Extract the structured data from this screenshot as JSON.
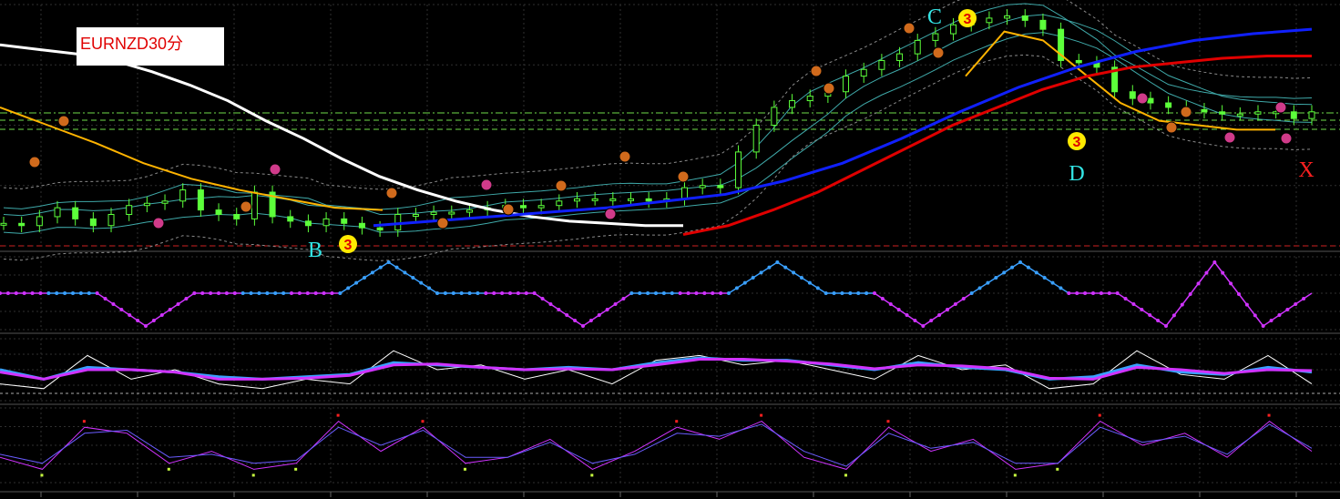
{
  "title": "EURNZD30分",
  "colors": {
    "background": "#000000",
    "grid": "#2f2f2f",
    "candle": "#5cff3a",
    "band": "#3fa9a9",
    "envelope": "#8a8a8a",
    "ma_white": "#ffffff",
    "ma_yellow": "#ffb300",
    "ma_blue": "#1020ff",
    "ma_red": "#e00000",
    "hline_green": "#6fdc4a",
    "hline_red": "#d02020",
    "marker_orange": "#d06a1c",
    "marker_pink": "#d03b8a",
    "marker_yellow": "#ffea00",
    "label_cyan": "#33e6e6",
    "label_red": "#ff2020",
    "osc_magenta": "#d033ff",
    "osc_blue": "#3aa0ff",
    "osc_white": "#ffffff"
  },
  "pattern_labels": [
    {
      "id": "B",
      "text": "B",
      "marker": "3"
    },
    {
      "id": "C",
      "text": "C",
      "marker": "3"
    },
    {
      "id": "D",
      "text": "D",
      "marker": "3"
    },
    {
      "id": "X",
      "text": "X",
      "marker": ""
    }
  ],
  "chart_data": {
    "type": "line",
    "symbol": "EURNZD",
    "timeframe": "30分",
    "panels": [
      {
        "name": "main",
        "series": [
          {
            "kind": "candles",
            "close": [
              6,
              5,
              9,
              13,
              8,
              5,
              10,
              14,
              15,
              16,
              21,
              12,
              10,
              8,
              20,
              9,
              7,
              5,
              8,
              6,
              4,
              3,
              10,
              10,
              11,
              11,
              12,
              13,
              14,
              13,
              14,
              16,
              17,
              17,
              17,
              17,
              16,
              17,
              22,
              23,
              22,
              38,
              50,
              58,
              61,
              63,
              65,
              72,
              75,
              79,
              82,
              88,
              91,
              95,
              96,
              98,
              99,
              97,
              93,
              79,
              78,
              76,
              65,
              62,
              60,
              58,
              57,
              56,
              55,
              55,
              56,
              56,
              53,
              56
            ]
          },
          {
            "kind": "ma",
            "color": "white",
            "values": [
              86,
              84,
              82,
              79,
              74,
              68,
              61,
              52,
              44,
              35,
              27,
              21,
              16,
              12,
              9,
              7,
              6,
              5,
              5
            ]
          },
          {
            "kind": "ma",
            "color": "yellow",
            "values": [
              58,
              50,
              42,
              33,
              26,
              21,
              17,
              13,
              12,
              72,
              92,
              88,
              74,
              60,
              52,
              50,
              48,
              48
            ]
          },
          {
            "kind": "ma",
            "color": "blue",
            "values": [
              5,
              7,
              9,
              11,
              13,
              16,
              19,
              25,
              33,
              44,
              56,
              67,
              76,
              83,
              88,
              91,
              93
            ]
          },
          {
            "kind": "ma",
            "color": "red",
            "values": [
              1,
              5,
              12,
              20,
              30,
              40,
              50,
              58,
              66,
              72,
              76,
              78,
              80,
              81,
              81
            ]
          }
        ]
      },
      {
        "name": "oscillator_1",
        "series": [
          {
            "kind": "step",
            "values": [
              0.5,
              0.5,
              0.5,
              -1,
              0.5,
              0.5,
              0.5,
              0.5,
              1,
              0.5,
              0.5,
              0.5,
              -1,
              0.5,
              0.5,
              0.5,
              1,
              0.5,
              0.5,
              -1,
              0.5,
              1,
              0.5,
              0.5,
              -1,
              1,
              -1,
              0.5
            ]
          }
        ]
      },
      {
        "name": "oscillator_2",
        "series": [
          {
            "name": "",
            "color": "white",
            "values": [
              0.2,
              0.1,
              0.8,
              0.3,
              0.5,
              0.2,
              0.1,
              0.3,
              0.2,
              0.9,
              0.5,
              0.6,
              0.3,
              0.5,
              0.2,
              0.7,
              0.8,
              0.6,
              0.7,
              0.5,
              0.3,
              0.8,
              0.5,
              0.6,
              0.1,
              0.2,
              0.9,
              0.4,
              0.3,
              0.8,
              0.2
            ]
          },
          {
            "name": "",
            "color": "blue",
            "values": [
              0.5,
              0.3,
              0.55,
              0.5,
              0.45,
              0.35,
              0.3,
              0.35,
              0.4,
              0.65,
              0.6,
              0.55,
              0.5,
              0.55,
              0.5,
              0.65,
              0.75,
              0.7,
              0.7,
              0.6,
              0.5,
              0.65,
              0.55,
              0.5,
              0.3,
              0.35,
              0.6,
              0.45,
              0.4,
              0.55,
              0.45
            ]
          },
          {
            "name": "",
            "color": "magenta",
            "values": [
              0.45,
              0.3,
              0.5,
              0.5,
              0.45,
              0.3,
              0.3,
              0.32,
              0.38,
              0.6,
              0.62,
              0.55,
              0.5,
              0.52,
              0.5,
              0.6,
              0.72,
              0.72,
              0.68,
              0.62,
              0.52,
              0.6,
              0.58,
              0.52,
              0.32,
              0.3,
              0.55,
              0.5,
              0.42,
              0.5,
              0.48
            ]
          }
        ]
      },
      {
        "name": "oscillator_3",
        "series": [
          {
            "name": "",
            "color": "magenta",
            "values": [
              0.3,
              0.1,
              0.8,
              0.7,
              0.2,
              0.4,
              0.1,
              0.2,
              0.9,
              0.4,
              0.8,
              0.2,
              0.3,
              0.6,
              0.1,
              0.4,
              0.8,
              0.6,
              0.9,
              0.3,
              0.1,
              0.8,
              0.4,
              0.6,
              0.1,
              0.2,
              0.9,
              0.5,
              0.7,
              0.3,
              0.9,
              0.4
            ]
          },
          {
            "name": "",
            "color": "blue",
            "values": [
              0.35,
              0.2,
              0.7,
              0.75,
              0.3,
              0.35,
              0.2,
              0.25,
              0.8,
              0.5,
              0.75,
              0.3,
              0.3,
              0.55,
              0.2,
              0.35,
              0.7,
              0.65,
              0.85,
              0.4,
              0.15,
              0.7,
              0.45,
              0.55,
              0.2,
              0.2,
              0.8,
              0.55,
              0.65,
              0.35,
              0.85,
              0.45
            ]
          }
        ]
      }
    ],
    "xlabel": "",
    "ylabel": "",
    "grid": true
  }
}
